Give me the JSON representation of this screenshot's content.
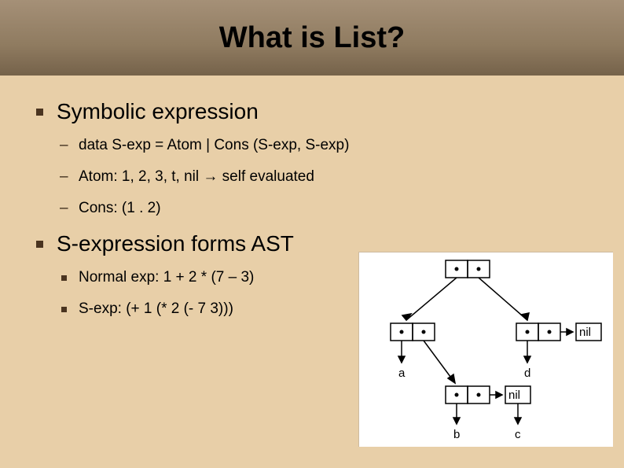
{
  "title": "What is List?",
  "bullets": [
    {
      "label": "Symbolic expression",
      "sub": [
        {
          "style": "dash",
          "text": "data S-exp = Atom | Cons (S-exp, S-exp)"
        },
        {
          "style": "dash",
          "text": "Atom: 1, 2, 3, t, nil → self evaluated"
        },
        {
          "style": "dash",
          "text": "Cons: (1 . 2)"
        }
      ]
    },
    {
      "label": "S-expression forms AST",
      "sub": [
        {
          "style": "square",
          "text": "Normal exp: 1 + 2 * (7 – 3)"
        },
        {
          "style": "square",
          "text": "S-exp: (+ 1 (* 2 (- 7 3)))"
        }
      ]
    }
  ],
  "diagram": {
    "labels": {
      "a": "a",
      "b": "b",
      "c": "c",
      "d": "d",
      "nil1": "nil",
      "nil2": "nil"
    }
  }
}
